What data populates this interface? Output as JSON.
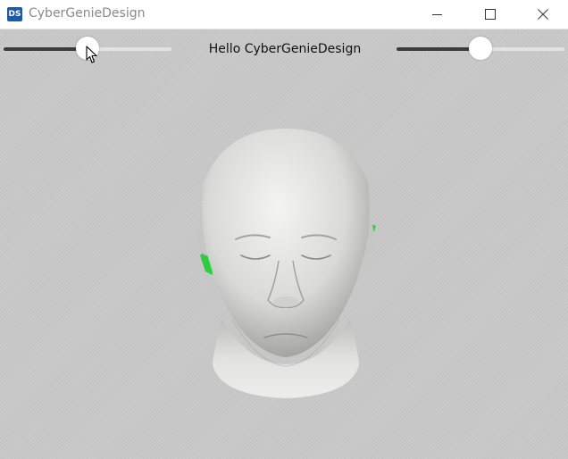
{
  "window": {
    "icon_text": "DS",
    "title": "CyberGenieDesign"
  },
  "controls": {
    "left_slider": {
      "value_fraction": 0.5
    },
    "right_slider": {
      "value_fraction": 0.5
    },
    "label": "Hello CyberGenieDesign"
  },
  "viewport": {
    "model": "3d-head-mesh",
    "marker_color": "#2ecc40"
  },
  "colors": {
    "slider_fill": "#3c3c3c",
    "slider_track": "#e2e2e2",
    "background": "#c9c9c9"
  }
}
